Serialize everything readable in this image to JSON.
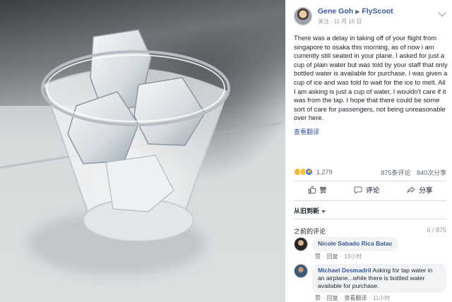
{
  "post": {
    "author": "Gene Goh",
    "target": "FlyScoot",
    "follow_label": "关注",
    "date": "11 月 16 日",
    "body": "There was a delay in taking off of your flight from singapore to osaka this morning, as of now i am currently still seated in your plane. I asked for just a cup of plain water but was told by your staff that only bottled water is available for purchase. I was given a cup of ice and was told to wait for the ice to melt. All I am asking is just a cup of water, I wouldn't care if it was from the tap. I hope that there could be some sort of care for passengers, not being unreasonable over here.",
    "see_translation": "查看翻译"
  },
  "stats": {
    "reaction_count": "1,279",
    "comments": "875条评论",
    "shares": "840次分享"
  },
  "actions": {
    "like": "赞",
    "comment": "评论",
    "share": "分享"
  },
  "comments_section": {
    "sort_label": "从旧到新",
    "previous_label": "之前的评论",
    "page_count": "6 / 875",
    "items": [
      {
        "author": "Nicole Sabado",
        "text": "Rica Batac",
        "like": "赞",
        "reply": "回复",
        "time": "13小时"
      },
      {
        "author": "Michael Desmadril",
        "text": "Asking for tap water in an airplane...while there is bottled water available for purchase.",
        "like": "赞",
        "reply": "回复",
        "translate": "查看翻译",
        "time": "11小时"
      }
    ]
  },
  "icons": [
    "avatar",
    "chevron-down-icon",
    "haha-reaction-icon",
    "wow-reaction-icon",
    "like-reaction-icon",
    "thumbs-up-icon",
    "comment-icon",
    "share-icon"
  ],
  "colors": {
    "link_blue": "#385898",
    "meta_gray": "#90949c",
    "bubble_bg": "#f2f3f5"
  }
}
